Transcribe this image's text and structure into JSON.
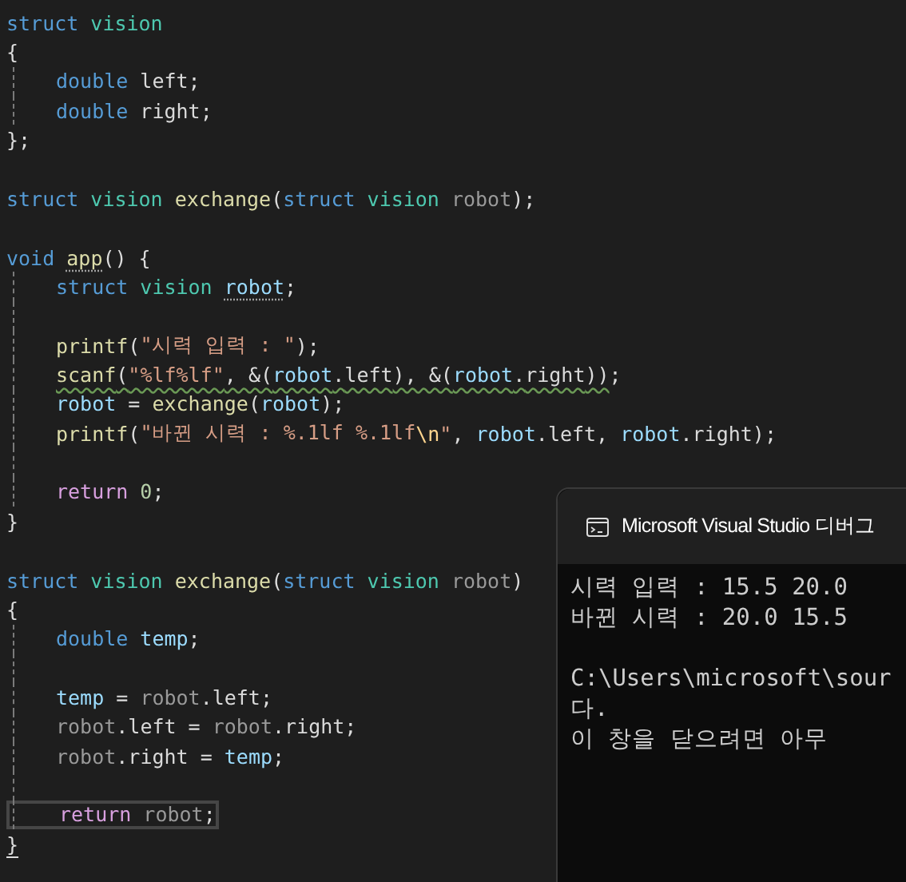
{
  "editor": {
    "lines": [
      {
        "indented": false,
        "tokens": [
          {
            "text": "struct",
            "kind": "kw"
          },
          {
            "text": " vision",
            "kind": "type"
          }
        ]
      },
      {
        "indented": false,
        "tokens": [
          {
            "text": "{"
          }
        ]
      },
      {
        "indented": true,
        "tokens": [
          {
            "text": "double",
            "kind": "kw"
          },
          {
            "text": " left",
            "kind": "field"
          },
          {
            "text": ";"
          }
        ]
      },
      {
        "indented": true,
        "tokens": [
          {
            "text": "double",
            "kind": "kw"
          },
          {
            "text": " right",
            "kind": "field"
          },
          {
            "text": ";"
          }
        ]
      },
      {
        "indented": false,
        "tokens": [
          {
            "text": "};"
          }
        ]
      },
      {
        "indented": false
      },
      {
        "indented": false,
        "tokens": [
          {
            "text": "struct",
            "kind": "kw"
          },
          {
            "text": " vision",
            "kind": "type"
          },
          {
            "text": " exchange",
            "kind": "fn"
          },
          {
            "text": "("
          },
          {
            "text": "struct",
            "kind": "kw"
          },
          {
            "text": " vision",
            "kind": "type"
          },
          {
            "text": " robot",
            "kind": "param"
          },
          {
            "text": ");"
          }
        ]
      },
      {
        "indented": false
      },
      {
        "indented": false,
        "tokens": [
          {
            "text": "void ",
            "kind": "kw"
          },
          {
            "text": "app",
            "kind": "fn",
            "hint": true
          },
          {
            "text": "() {"
          }
        ]
      },
      {
        "indented": true,
        "tokens": [
          {
            "text": "struct",
            "kind": "kw"
          },
          {
            "text": " vision ",
            "kind": "type"
          },
          {
            "text": "robot",
            "kind": "var",
            "hint": true
          },
          {
            "text": ";"
          }
        ]
      },
      {
        "indented": true
      },
      {
        "indented": true,
        "tokens": [
          {
            "text": "printf",
            "kind": "fn"
          },
          {
            "text": "("
          },
          {
            "text": "\"시력 입력 : \"",
            "kind": "str"
          },
          {
            "text": ");"
          }
        ]
      },
      {
        "indented": true,
        "tokens": [
          {
            "text": "scanf",
            "kind": "fn",
            "warning": true
          },
          {
            "text": "(",
            "warning": true
          },
          {
            "text": "\"%lf%lf\"",
            "kind": "str",
            "warning": true
          },
          {
            "text": ", &(",
            "warning": true
          },
          {
            "text": "robot",
            "kind": "var",
            "warning": true
          },
          {
            "text": ".",
            "warning": true
          },
          {
            "text": "left",
            "kind": "field",
            "warning": true
          },
          {
            "text": "), &(",
            "warning": true
          },
          {
            "text": "robot",
            "kind": "var",
            "warning": true
          },
          {
            "text": ".",
            "warning": true
          },
          {
            "text": "right",
            "kind": "field",
            "warning": true
          },
          {
            "text": "))",
            "warning": true
          },
          {
            "text": ";"
          }
        ]
      },
      {
        "indented": true,
        "tokens": [
          {
            "text": "robot",
            "kind": "var"
          },
          {
            "text": " = "
          },
          {
            "text": "exchange",
            "kind": "fn"
          },
          {
            "text": "("
          },
          {
            "text": "robot",
            "kind": "var"
          },
          {
            "text": ");"
          }
        ]
      },
      {
        "indented": true,
        "tokens": [
          {
            "text": "printf",
            "kind": "fn"
          },
          {
            "text": "("
          },
          {
            "text": "\"바뀐 시력 : %.1lf %.1lf",
            "kind": "str"
          },
          {
            "text": "\\n",
            "kind": "esc"
          },
          {
            "text": "\"",
            "kind": "str"
          },
          {
            "text": ", "
          },
          {
            "text": "robot",
            "kind": "var"
          },
          {
            "text": "."
          },
          {
            "text": "left",
            "kind": "field"
          },
          {
            "text": ", "
          },
          {
            "text": "robot",
            "kind": "var"
          },
          {
            "text": "."
          },
          {
            "text": "right",
            "kind": "field"
          },
          {
            "text": ");"
          }
        ]
      },
      {
        "indented": true
      },
      {
        "indented": true,
        "tokens": [
          {
            "text": "return",
            "kind": "ctrl"
          },
          {
            "text": " 0",
            "kind": "num"
          },
          {
            "text": ";"
          }
        ]
      },
      {
        "indented": false,
        "tokens": [
          {
            "text": "}"
          }
        ]
      },
      {
        "indented": false
      },
      {
        "indented": false,
        "tokens": [
          {
            "text": "struct",
            "kind": "kw"
          },
          {
            "text": " vision",
            "kind": "type"
          },
          {
            "text": " exchange",
            "kind": "fn"
          },
          {
            "text": "("
          },
          {
            "text": "struct",
            "kind": "kw"
          },
          {
            "text": " vision",
            "kind": "type"
          },
          {
            "text": " robot",
            "kind": "param"
          },
          {
            "text": ")"
          }
        ]
      },
      {
        "indented": false,
        "tokens": [
          {
            "text": "{"
          }
        ]
      },
      {
        "indented": true,
        "tokens": [
          {
            "text": "double",
            "kind": "kw"
          },
          {
            "text": " temp",
            "kind": "var"
          },
          {
            "text": ";"
          }
        ]
      },
      {
        "indented": true
      },
      {
        "indented": true,
        "tokens": [
          {
            "text": "temp",
            "kind": "var"
          },
          {
            "text": " = "
          },
          {
            "text": "robot",
            "kind": "param"
          },
          {
            "text": "."
          },
          {
            "text": "left",
            "kind": "field"
          },
          {
            "text": ";"
          }
        ]
      },
      {
        "indented": true,
        "tokens": [
          {
            "text": "robot",
            "kind": "param"
          },
          {
            "text": "."
          },
          {
            "text": "left",
            "kind": "field"
          },
          {
            "text": " = "
          },
          {
            "text": "robot",
            "kind": "param"
          },
          {
            "text": "."
          },
          {
            "text": "right",
            "kind": "field"
          },
          {
            "text": ";"
          }
        ]
      },
      {
        "indented": true,
        "tokens": [
          {
            "text": "robot",
            "kind": "param"
          },
          {
            "text": "."
          },
          {
            "text": "right",
            "kind": "field"
          },
          {
            "text": " = "
          },
          {
            "text": "temp",
            "kind": "var"
          },
          {
            "text": ";"
          }
        ]
      },
      {
        "indented": true
      },
      {
        "indented": true,
        "current": true,
        "tokens": [
          {
            "text": "return",
            "kind": "ctrl"
          },
          {
            "text": " robot",
            "kind": "param"
          },
          {
            "text": ";"
          }
        ]
      },
      {
        "indented": false,
        "tokens": [
          {
            "text": "}",
            "brace_match": true
          }
        ]
      }
    ]
  },
  "console": {
    "title": "Microsoft Visual Studio 디버그",
    "output": [
      "시력 입력 : 15.5 20.0",
      "바뀐 시력 : 20.0 15.5"
    ],
    "exit_message": [
      "C:\\Users\\microsoft\\sour",
      "다.",
      "이 창을 닫으려면 아무"
    ]
  }
}
